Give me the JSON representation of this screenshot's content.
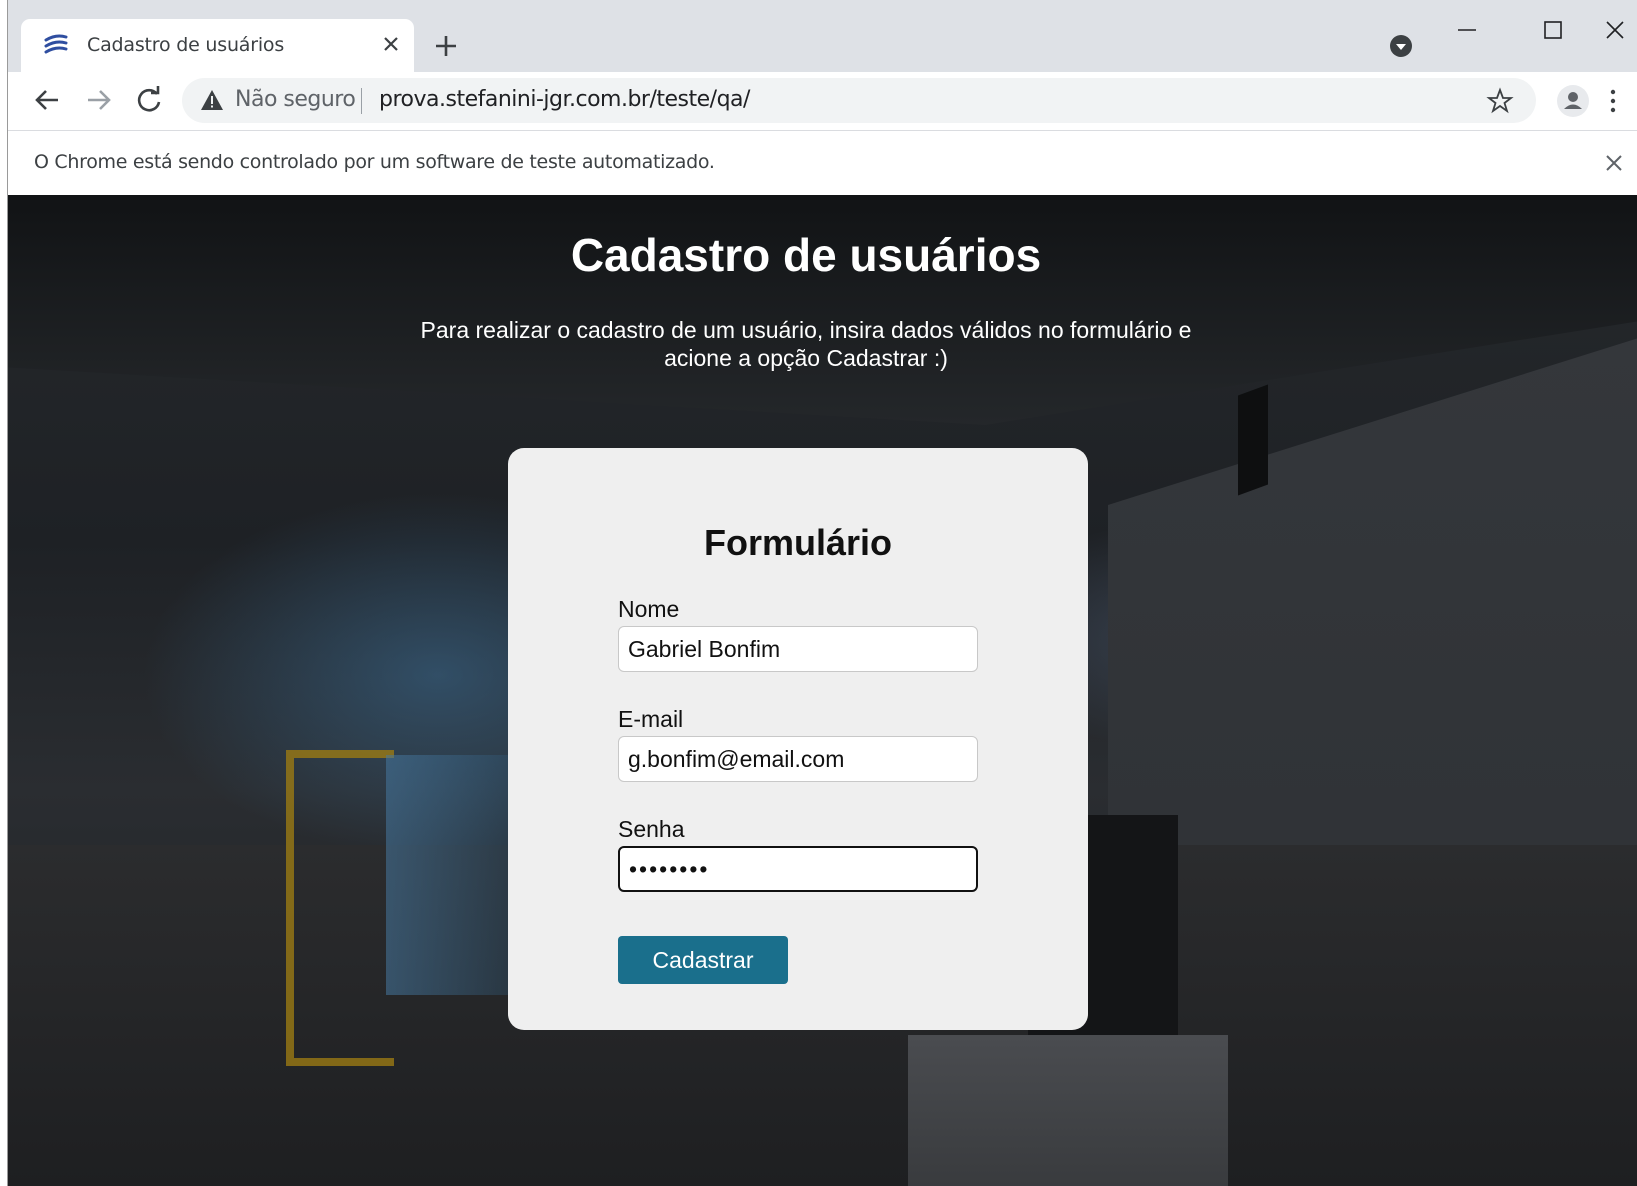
{
  "browser": {
    "tab": {
      "title": "Cadastro de usuários",
      "favicon": "stefanini-logo-icon",
      "close_icon": "close-icon"
    },
    "new_tab_icon": "plus-icon",
    "window_controls": [
      "minimize-icon",
      "maximize-icon",
      "close-icon"
    ],
    "address_bar": {
      "security_label": "Não seguro",
      "security_icon": "warning-icon",
      "url": "prova.stefanini-jgr.com.br/teste/qa/"
    },
    "infobar": {
      "message": "O Chrome está sendo controlado por um software de teste automatizado."
    }
  },
  "page": {
    "title": "Cadastro de usuários",
    "subtitle": "Para realizar o cadastro de um usuário, insira dados válidos no formulário e acione a opção Cadastrar :)",
    "form": {
      "title": "Formulário",
      "fields": [
        {
          "label": "Nome",
          "value": "Gabriel Bonfim"
        },
        {
          "label": "E-mail",
          "value": "g.bonfim@email.com"
        },
        {
          "label": "Senha",
          "value": "••••••••"
        }
      ],
      "submit_label": "Cadastrar"
    }
  },
  "colors": {
    "button_bg": "#1a6f8c",
    "card_bg": "#efefef",
    "tabstrip_bg": "#dee1e6"
  }
}
